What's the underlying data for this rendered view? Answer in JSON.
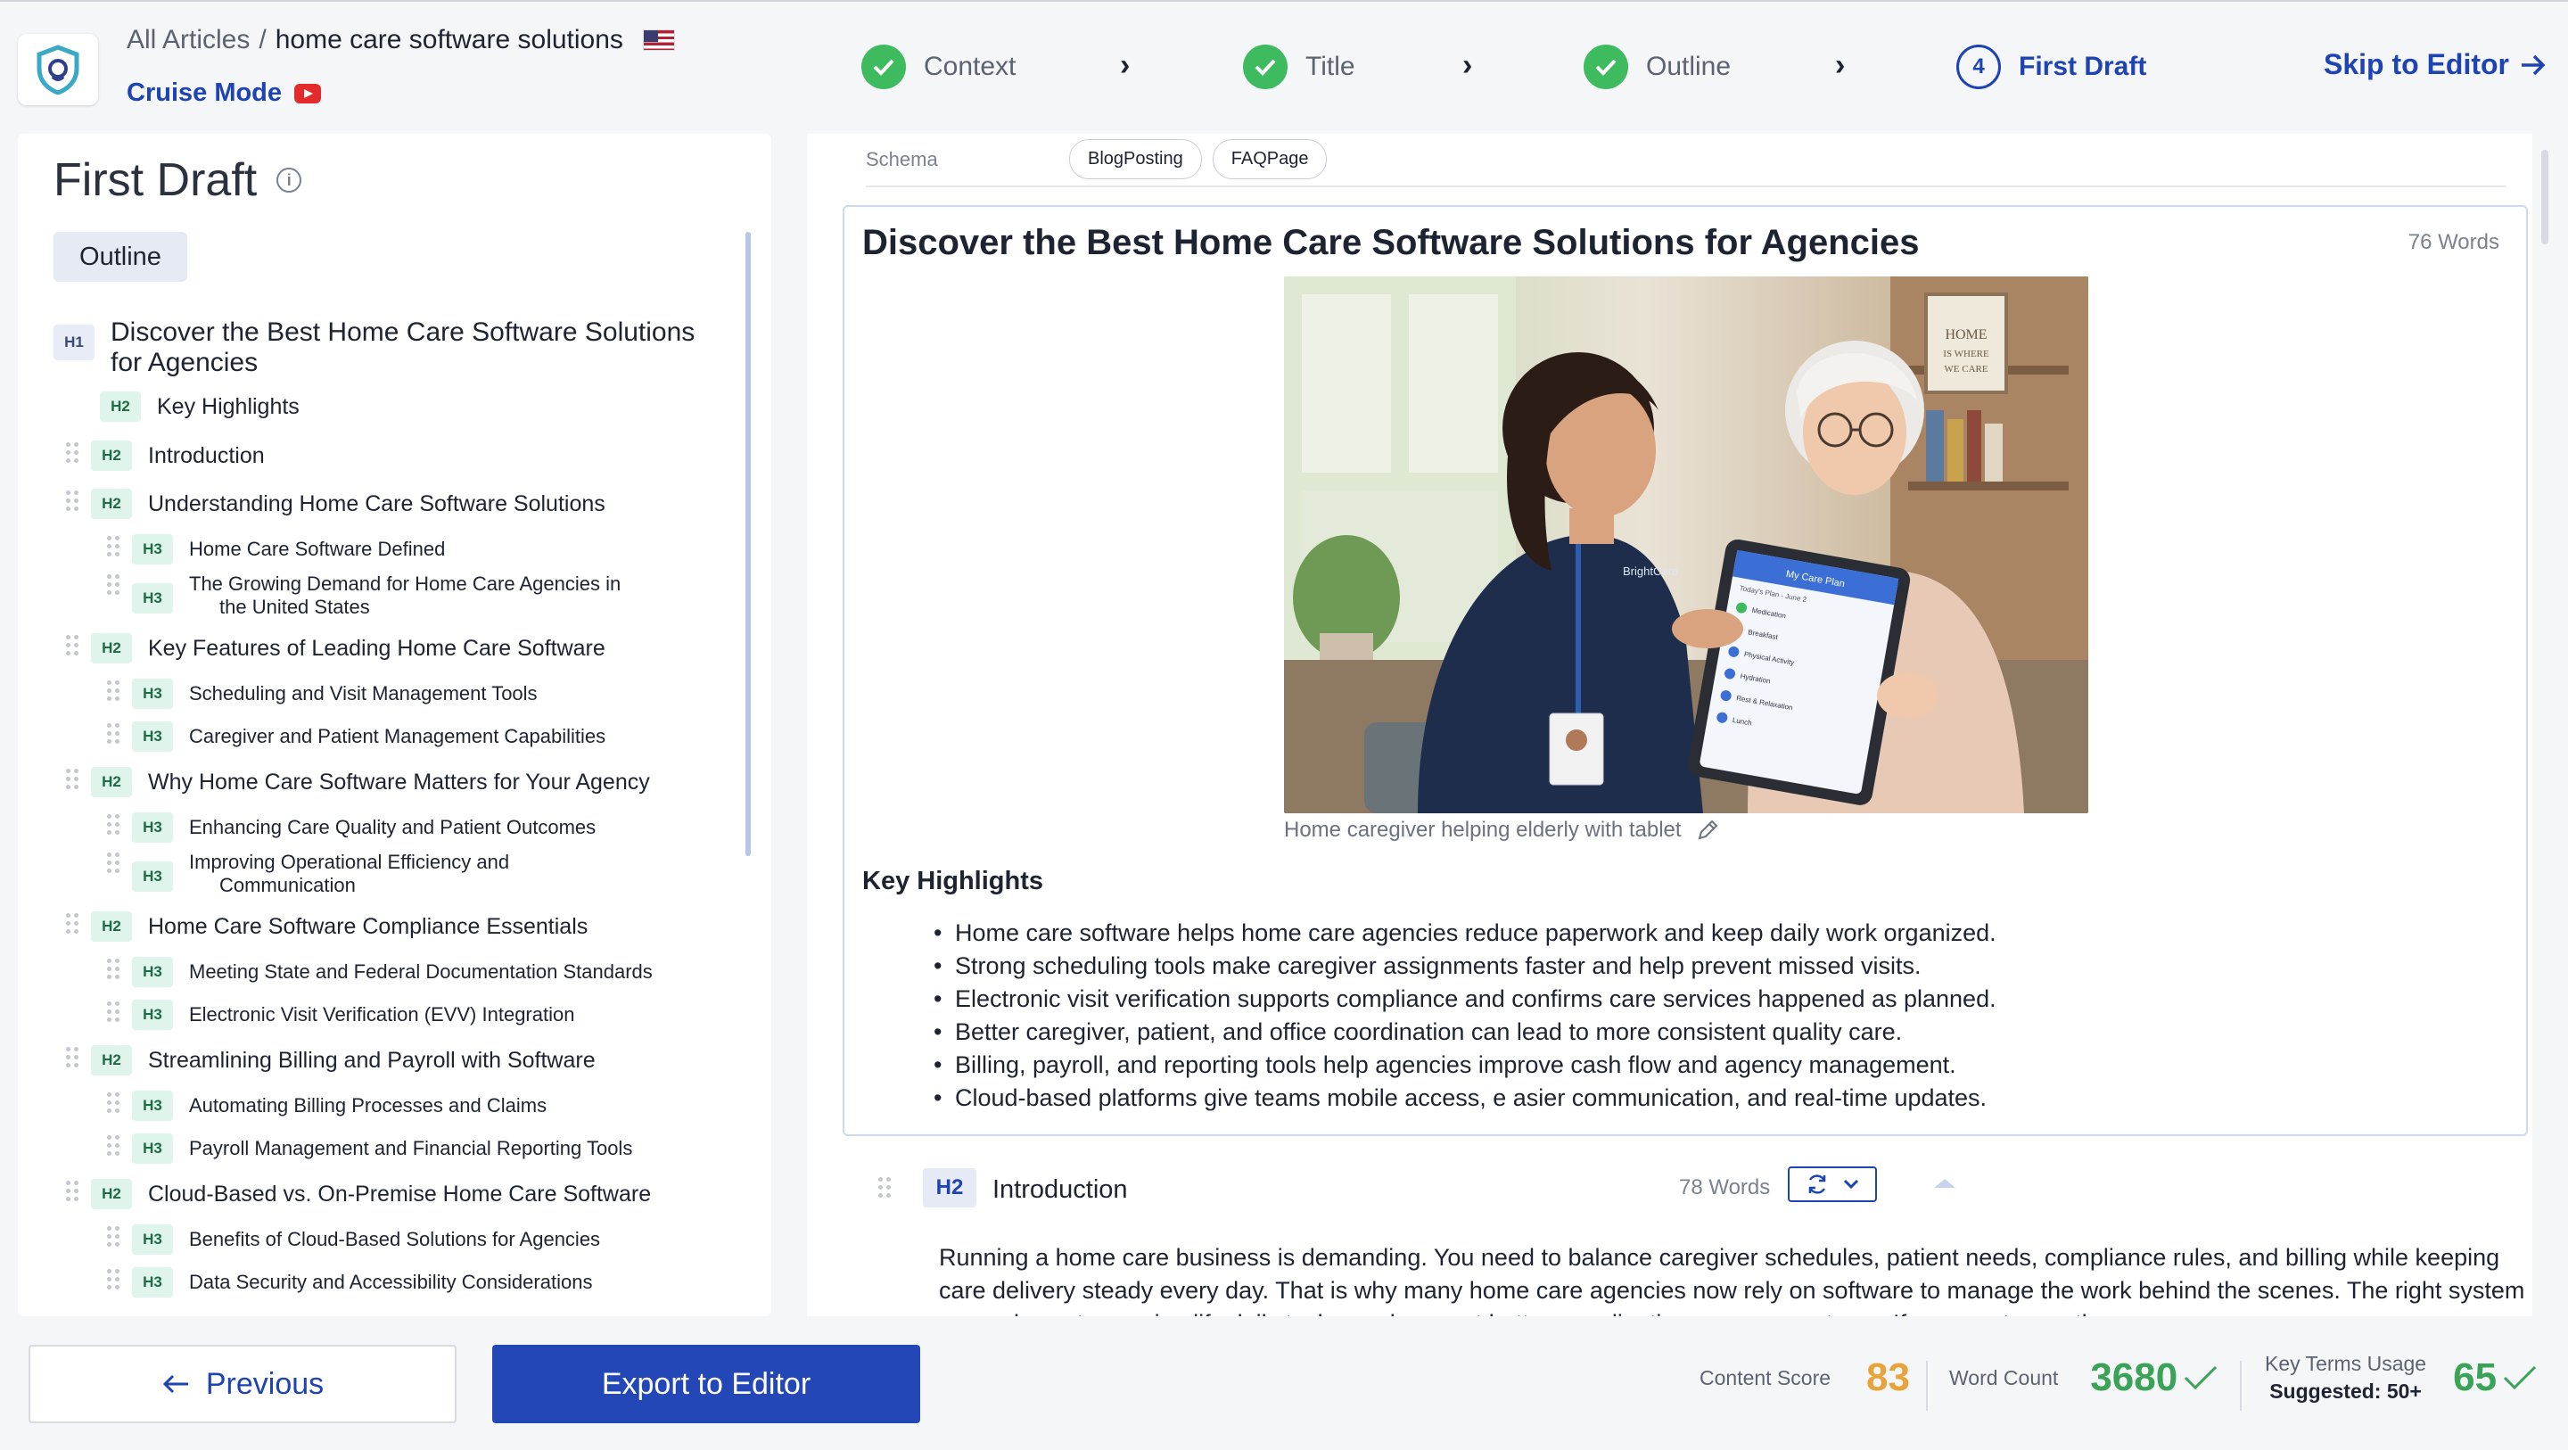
{
  "header": {
    "breadcrumb_root": "All Articles",
    "breadcrumb_sep": "/",
    "breadcrumb_current": "home care software solutions",
    "cruise_mode": "Cruise Mode",
    "steps": [
      {
        "label": "Context",
        "state": "done"
      },
      {
        "label": "Title",
        "state": "done"
      },
      {
        "label": "Outline",
        "state": "done"
      },
      {
        "label": "First Draft",
        "state": "current",
        "number": "4"
      }
    ],
    "skip_label": "Skip to Editor"
  },
  "colors": {
    "accent": "#1e43b3",
    "success": "#3dbb5e",
    "score_orange": "#e8a43b",
    "count_green": "#3aa357"
  },
  "left_panel": {
    "title": "First Draft",
    "outline_tab": "Outline",
    "items": [
      {
        "tag": "H1",
        "text": "Discover the Best Home Care Software Solutions"
      },
      {
        "tag": "",
        "text": "for Agencies"
      },
      {
        "tag": "H2",
        "text": "Key Highlights"
      },
      {
        "tag": "H2",
        "text": "Introduction"
      },
      {
        "tag": "H2",
        "text": "Understanding Home Care Software Solutions"
      },
      {
        "tag": "H3",
        "text": "Home Care Software Defined"
      },
      {
        "tag": "H3",
        "text": "The Growing Demand for Home Care Agencies in"
      },
      {
        "tag": "",
        "text": "the United States"
      },
      {
        "tag": "H2",
        "text": "Key Features of Leading Home Care Software"
      },
      {
        "tag": "H3",
        "text": "Scheduling and Visit Management Tools"
      },
      {
        "tag": "H3",
        "text": "Caregiver and Patient Management Capabilities"
      },
      {
        "tag": "H2",
        "text": "Why Home Care Software Matters for Your Agency"
      },
      {
        "tag": "H3",
        "text": "Enhancing Care Quality and Patient Outcomes"
      },
      {
        "tag": "H3",
        "text": "Improving Operational Efficiency and"
      },
      {
        "tag": "",
        "text": "Communication"
      },
      {
        "tag": "H2",
        "text": "Home Care Software Compliance Essentials"
      },
      {
        "tag": "H3",
        "text": "Meeting State and Federal Documentation Standards"
      },
      {
        "tag": "H3",
        "text": "Electronic Visit Verification (EVV) Integration"
      },
      {
        "tag": "H2",
        "text": "Streamlining Billing and Payroll with Software"
      },
      {
        "tag": "H3",
        "text": "Automating Billing Processes and Claims"
      },
      {
        "tag": "H3",
        "text": "Payroll Management and Financial Reporting Tools"
      },
      {
        "tag": "H2",
        "text": "Cloud-Based vs. On-Premise Home Care Software"
      },
      {
        "tag": "H3",
        "text": "Benefits of Cloud-Based Solutions for Agencies"
      },
      {
        "tag": "H3",
        "text": "Data Security and Accessibility Considerations"
      }
    ]
  },
  "main": {
    "schema_label": "Schema",
    "schema_pills": [
      "BlogPosting",
      "FAQPage"
    ],
    "h1": "Discover the Best Home Care Software Solutions for Agencies",
    "h1_words": "76 Words",
    "image_caption": "Home caregiver helping elderly with tablet",
    "image_texts": {
      "sign1": "HOME",
      "sign2": "IS WHERE",
      "sign3": "WE CARE",
      "brand": "BrightCare",
      "tablet_title": "My Care Plan",
      "tablet_sub": "Today's Plan - June 2",
      "tablet_rows": [
        "Medication",
        "Breakfast",
        "Physical Activity",
        "Hydration",
        "Rest & Relaxation",
        "Lunch"
      ]
    },
    "key_highlights_title": "Key Highlights",
    "bullets": [
      "Home care software helps home care agencies reduce paperwork and keep daily work organized.",
      "Strong scheduling tools make caregiver assignments faster and help prevent missed visits.",
      "Electronic visit verification supports compliance and confirms care services happened as planned.",
      "Better caregiver, patient, and office coordination can lead to more consistent quality care.",
      "Billing, payroll, and reporting tools help agencies improve cash flow and agency management.",
      "Cloud-based platforms give teams mobile access, e asier communication, and real-time updates."
    ],
    "intro": {
      "tag": "H2",
      "title": "Introduction",
      "words": "78 Words",
      "paragraph": "Running a home care business is demanding. You need to balance caregiver schedules, patient needs, compliance rules, and billing while keeping care delivery steady every day. That is why many home care agencies now rely on software to manage the work behind the scenes. The right system can reduce stress, simplify daily tasks, and support better coordination across your team. If you want smoother"
    }
  },
  "footer": {
    "previous": "Previous",
    "export": "Export to Editor",
    "content_score_label": "Content Score",
    "content_score": "83",
    "word_count_label": "Word Count",
    "word_count": "3680",
    "key_terms_label": "Key Terms Usage",
    "key_terms_suggested": "Suggested: 50+",
    "key_terms_value": "65"
  }
}
